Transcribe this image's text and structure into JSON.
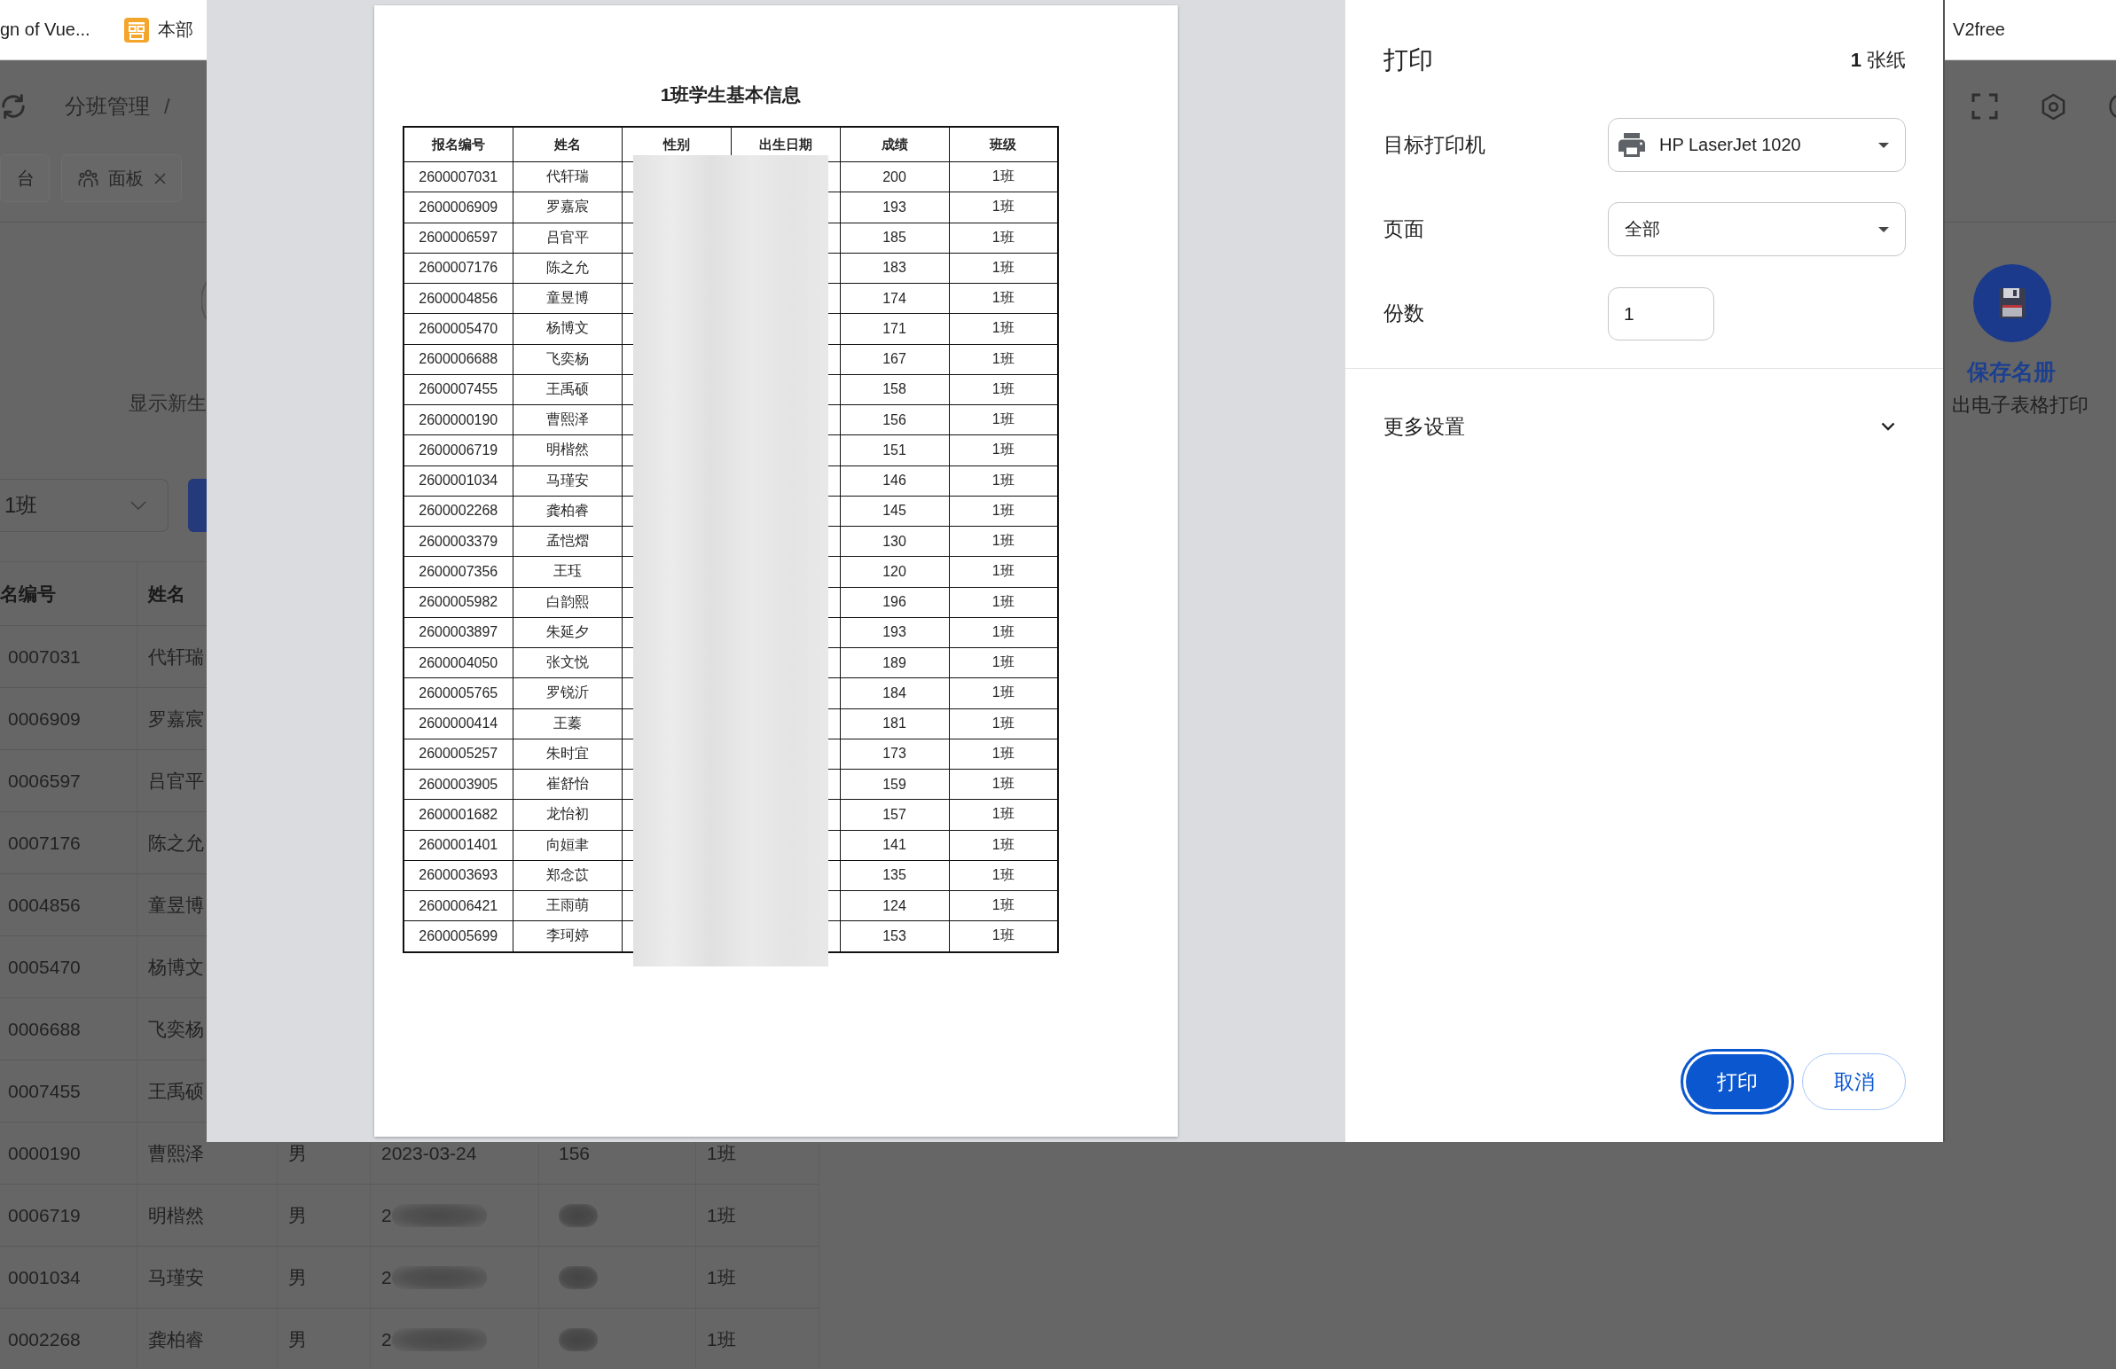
{
  "bookmark_bar": {
    "left_items": [
      {
        "label": "gn of Vue...",
        "has_icon": false
      },
      {
        "label": "本部",
        "has_icon": true
      }
    ],
    "right_items": [
      {
        "label": "V2free",
        "has_icon": false
      }
    ]
  },
  "app_header": {
    "breadcrumb": [
      {
        "kind": "link",
        "text": "分班管理"
      },
      {
        "kind": "separator",
        "text": "/"
      }
    ]
  },
  "tabs": [
    {
      "label": "台",
      "selected": false,
      "has_icon": false,
      "closable": false
    },
    {
      "label": "面板",
      "selected": false,
      "has_icon": true,
      "closable": true
    }
  ],
  "summary_card": {
    "subtitle": "显示新生"
  },
  "save_action": {
    "title": "保存名册",
    "subtitle": "出电子表格打印"
  },
  "class_select": {
    "value": "1班"
  },
  "student_table": {
    "columns": [
      "名编号",
      "姓名"
    ],
    "rows": [
      {
        "cells": [
          "0007031",
          "代轩瑞"
        ]
      },
      {
        "cells": [
          "0006909",
          "罗嘉宸"
        ]
      },
      {
        "cells": [
          "0006597",
          "吕官平"
        ]
      },
      {
        "cells": [
          "0007176",
          "陈之允"
        ]
      },
      {
        "cells": [
          "0004856",
          "童昱博"
        ]
      },
      {
        "cells": [
          "0005470",
          "杨博文"
        ]
      },
      {
        "cells": [
          "0006688",
          "飞奕杨"
        ]
      },
      {
        "cells": [
          "0007455",
          "王禹硕"
        ]
      },
      {
        "cells": [
          "0000190",
          "曹熙泽",
          "男",
          "2023-03-24",
          "156",
          "1班"
        ]
      },
      {
        "cells": [
          "0006719",
          "明楷然",
          "男",
          {
            "text": "2",
            "blurred": true
          },
          {
            "blurred": true
          },
          "1班"
        ]
      },
      {
        "cells": [
          "0001034",
          "马瑾安",
          "男",
          {
            "text": "2",
            "blurred": true
          },
          {
            "blurred": true
          },
          "1班"
        ]
      },
      {
        "cells": [
          "0002268",
          "龚柏睿",
          "男",
          {
            "text": "2",
            "blurred": true
          },
          {
            "blurred": true
          },
          "1班"
        ]
      }
    ]
  },
  "print_dialog": {
    "preview": {
      "title": "1班学生基本信息",
      "columns": [
        {
          "label": "报名编号",
          "redacted": false
        },
        {
          "label": "姓名",
          "redacted": false
        },
        {
          "label": "性别",
          "redacted": true
        },
        {
          "label": "出生日期",
          "redacted": true
        },
        {
          "label": "成绩",
          "redacted": false
        },
        {
          "label": "班级",
          "redacted": false
        }
      ],
      "rows": [
        [
          "2600007031",
          "代轩瑞",
          "200",
          "1班"
        ],
        [
          "2600006909",
          "罗嘉宸",
          "193",
          "1班"
        ],
        [
          "2600006597",
          "吕官平",
          "185",
          "1班"
        ],
        [
          "2600007176",
          "陈之允",
          "183",
          "1班"
        ],
        [
          "2600004856",
          "童昱博",
          "174",
          "1班"
        ],
        [
          "2600005470",
          "杨博文",
          "171",
          "1班"
        ],
        [
          "2600006688",
          "飞奕杨",
          "167",
          "1班"
        ],
        [
          "2600007455",
          "王禹硕",
          "158",
          "1班"
        ],
        [
          "2600000190",
          "曹熙泽",
          "156",
          "1班"
        ],
        [
          "2600006719",
          "明楷然",
          "151",
          "1班"
        ],
        [
          "2600001034",
          "马瑾安",
          "146",
          "1班"
        ],
        [
          "2600002268",
          "龚柏睿",
          "145",
          "1班"
        ],
        [
          "2600003379",
          "孟恺熠",
          "130",
          "1班"
        ],
        [
          "2600007356",
          "王珏",
          "120",
          "1班"
        ],
        [
          "2600005982",
          "白韵熙",
          "196",
          "1班"
        ],
        [
          "2600003897",
          "朱延夕",
          "193",
          "1班"
        ],
        [
          "2600004050",
          "张文悦",
          "189",
          "1班"
        ],
        [
          "2600005765",
          "罗锐沂",
          "184",
          "1班"
        ],
        [
          "2600000414",
          "王蓁",
          "181",
          "1班"
        ],
        [
          "2600005257",
          "朱时宜",
          "173",
          "1班"
        ],
        [
          "2600003905",
          "崔舒怡",
          "159",
          "1班"
        ],
        [
          "2600001682",
          "龙怡初",
          "157",
          "1班"
        ],
        [
          "2600001401",
          "向姮聿",
          "141",
          "1班"
        ],
        [
          "2600003693",
          "郑念苡",
          "135",
          "1班"
        ],
        [
          "2600006421",
          "王雨萌",
          "124",
          "1班"
        ],
        [
          "2600005699",
          "李珂婷",
          "153",
          "1班"
        ]
      ]
    },
    "settings": {
      "title": "打印",
      "sheet_count": "**1** 张纸",
      "fields": [
        {
          "label": "目标打印机",
          "kind": "select",
          "value": "HP LaserJet 1020",
          "has_icon": true
        },
        {
          "label": "页面",
          "kind": "select",
          "value": "全部",
          "has_icon": false
        },
        {
          "label": "份数",
          "kind": "input",
          "value": "1"
        }
      ],
      "more_settings": {
        "label": "更多设置",
        "expanded": false
      },
      "buttons": [
        {
          "label": "打印",
          "kind": "primary",
          "focused": true
        },
        {
          "label": "取消",
          "kind": "secondary",
          "focused": false
        }
      ]
    }
  }
}
